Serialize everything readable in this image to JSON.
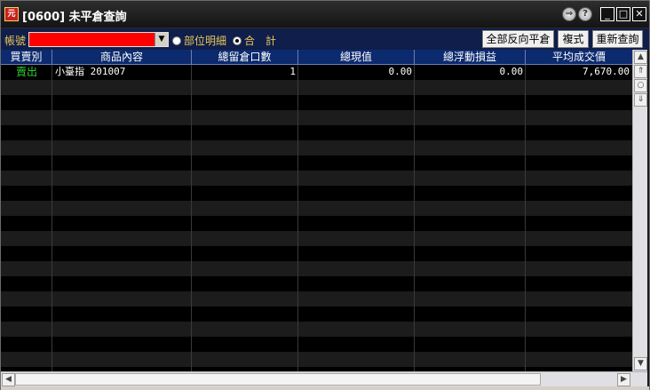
{
  "window": {
    "title": "[0600] 未平倉查詢",
    "app_icon": "元"
  },
  "titlebar_buttons": {
    "link_glyph": "⇒",
    "help_glyph": "?",
    "minimize_glyph": "_",
    "maximize_glyph": "□",
    "close_glyph": "✕"
  },
  "toolbar": {
    "account_label": "帳號",
    "account_value": "",
    "radio_detail": "部位明細",
    "radio_total": "合　計",
    "selected_radio": "total",
    "btn_reverse_all": "全部反向平倉",
    "btn_complex": "複式",
    "btn_requery": "重新查詢"
  },
  "table": {
    "columns": [
      "買賣別",
      "商品內容",
      "總留倉口數",
      "總現值",
      "總浮動損益",
      "平均成交價"
    ],
    "rows": [
      {
        "side": "賣出",
        "product": "小臺指 201007",
        "qty": "1",
        "value": "0.00",
        "pnl": "0.00",
        "avg_price": "7,670.00"
      }
    ]
  },
  "colors": {
    "sell": "#2ed12e",
    "header_bg": "#0c2a6e",
    "toolbar_bg": "#0f1e4a",
    "account_field": "#ff0000",
    "label_gold": "#e8c85a"
  }
}
